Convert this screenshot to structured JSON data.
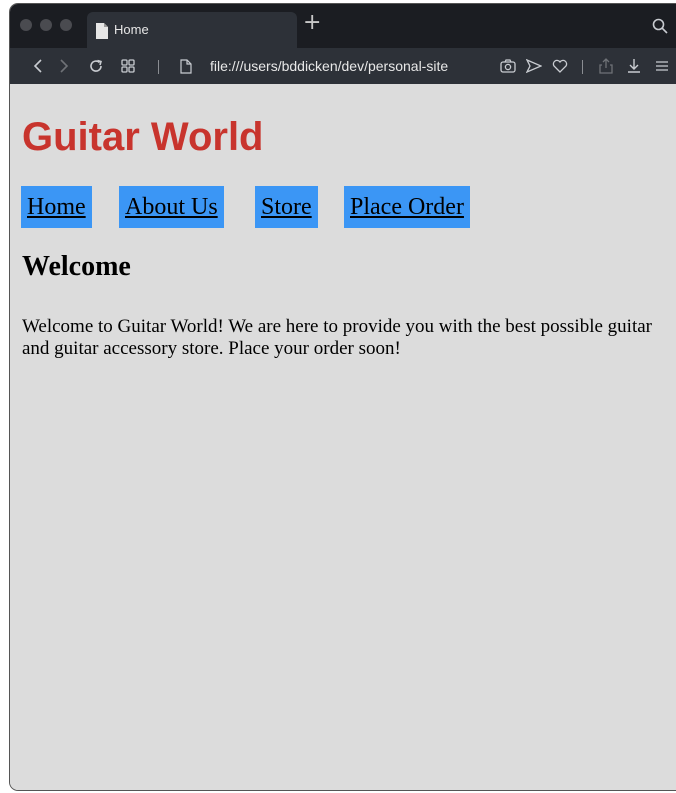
{
  "browser": {
    "tab_title": "Home",
    "new_tab_symbol": "+",
    "url": "file:///users/bddicken/dev/personal-site"
  },
  "page": {
    "site_title": "Guitar World",
    "nav": [
      "Home",
      "About Us",
      "Store",
      "Place Order"
    ],
    "heading": "Welcome",
    "body": "Welcome to Guitar World! We are here to provide you with the best possible guitar and guitar accessory store. Place your order soon!"
  },
  "colors": {
    "title_red": "#c8342d",
    "nav_blue": "#3b96f5",
    "page_background": "#dcdcdc",
    "browser_chrome": "#1b1d22",
    "toolbar": "#2d3138"
  }
}
